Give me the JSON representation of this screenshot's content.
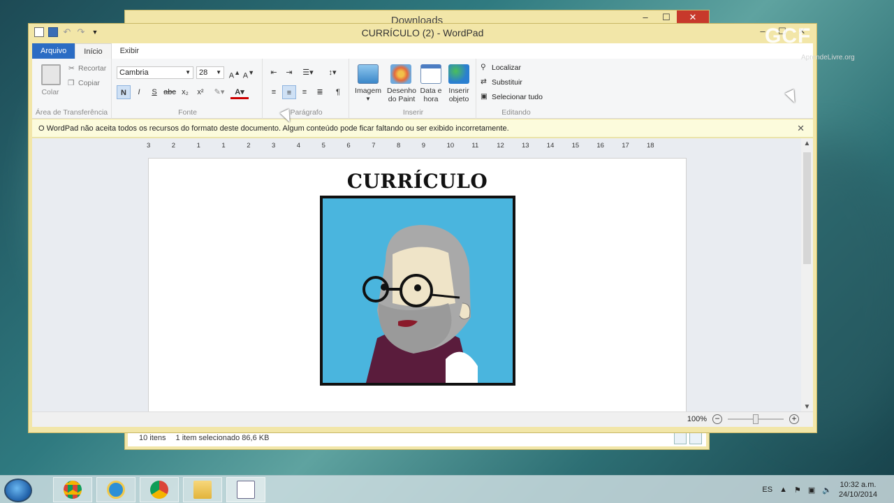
{
  "background_window": {
    "title": "Downloads",
    "status_items": "10 itens",
    "status_selected": "1 item selecionado  86,6 KB"
  },
  "window": {
    "title": "CURRÍCULO (2) - WordPad"
  },
  "tabs": [
    "Arquivo",
    "Início",
    "Exibir"
  ],
  "clipboard": {
    "paste": "Colar",
    "cut": "Recortar",
    "copy": "Copiar",
    "label": "Área de Transferência"
  },
  "font": {
    "family": "Cambria",
    "size": "28",
    "bold": "N",
    "italic": "I",
    "underline": "S",
    "strike": "abc",
    "subscript": "x₂",
    "superscript": "x²",
    "label": "Fonte"
  },
  "paragraph": {
    "label": "Parágrafo"
  },
  "insert": {
    "image": "Imagem",
    "paint_line1": "Desenho",
    "paint_line2": "do Paint",
    "date_line1": "Data e",
    "date_line2": "hora",
    "object_line1": "Inserir",
    "object_line2": "objeto",
    "label": "Inserir"
  },
  "editing": {
    "find": "Localizar",
    "replace": "Substituir",
    "select_all": "Selecionar tudo",
    "label": "Editando"
  },
  "infobar": {
    "message": "O WordPad não aceita todos os recursos do formato deste documento. Algum conteúdo pode ficar faltando ou ser exibido incorretamente."
  },
  "ruler": [
    "3",
    "2",
    "1",
    "1",
    "2",
    "3",
    "4",
    "5",
    "6",
    "7",
    "8",
    "9",
    "10",
    "11",
    "12",
    "13",
    "14",
    "15",
    "16",
    "17",
    "18"
  ],
  "document": {
    "heading": "CURRÍCULO"
  },
  "statusbar": {
    "zoom": "100%"
  },
  "watermark": {
    "logo": "GCF",
    "sub": "AprendeLivre.org"
  },
  "taskbar": {
    "language": "ES",
    "time": "10:32 a.m.",
    "date": "24/10/2014"
  },
  "colors": {
    "window_frame": "#f2e6a8",
    "file_tab": "#2b6cc4",
    "infobar": "#fcfbdc",
    "portrait_bg": "#4ab5de"
  }
}
